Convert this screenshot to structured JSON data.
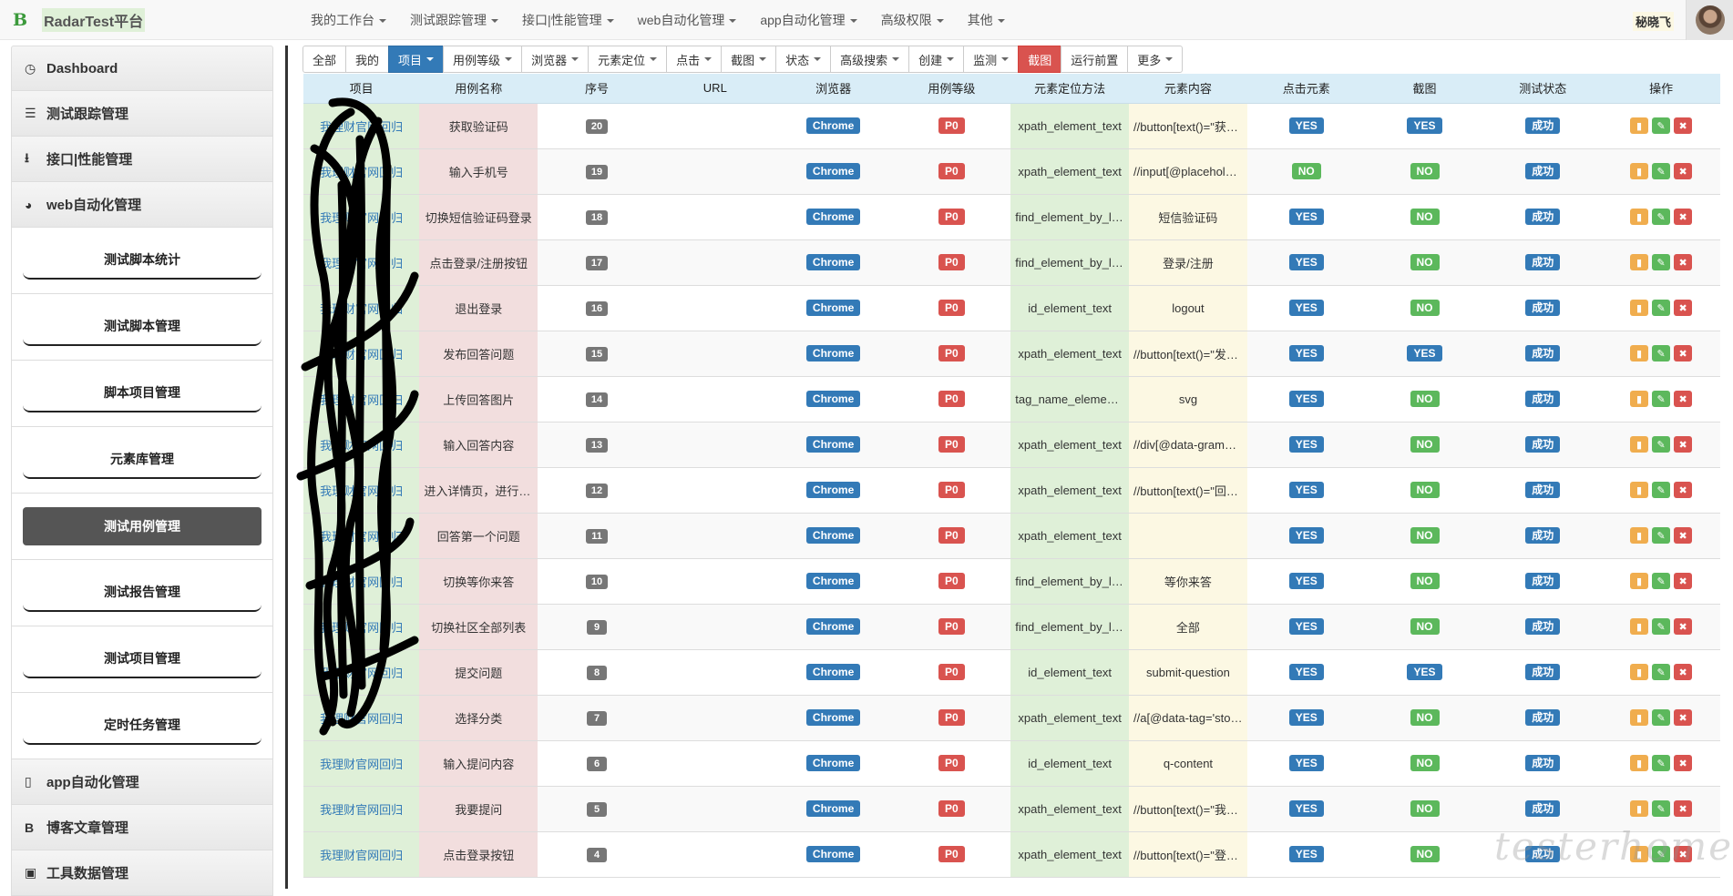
{
  "brand": {
    "logo": "B",
    "name": "RadarTest平台"
  },
  "topnav": [
    "我的工作台",
    "测试跟踪管理",
    "接口|性能管理",
    "web自动化管理",
    "app自动化管理",
    "高级权限",
    "其他"
  ],
  "user": {
    "name": "秘晓飞"
  },
  "sidebar": {
    "top": [
      {
        "label": "Dashboard",
        "icon": "clock-icon"
      },
      {
        "label": "测试跟踪管理",
        "icon": "list-icon"
      },
      {
        "label": "接口|性能管理",
        "icon": "download-icon"
      },
      {
        "label": "web自动化管理",
        "icon": "globe-icon"
      }
    ],
    "sub": [
      {
        "label": "测试脚本统计"
      },
      {
        "label": "测试脚本管理"
      },
      {
        "label": "脚本项目管理"
      },
      {
        "label": "元素库管理"
      },
      {
        "label": "测试用例管理",
        "active": true
      },
      {
        "label": "测试报告管理"
      },
      {
        "label": "测试项目管理"
      },
      {
        "label": "定时任务管理"
      }
    ],
    "bottom": [
      {
        "label": "app自动化管理",
        "icon": "mobile-icon"
      },
      {
        "label": "博客文章管理",
        "icon": "b-icon"
      },
      {
        "label": "工具数据管理",
        "icon": "briefcase-icon"
      }
    ]
  },
  "filters": [
    {
      "label": "全部",
      "caret": false,
      "style": ""
    },
    {
      "label": "我的",
      "caret": false,
      "style": ""
    },
    {
      "label": "项目",
      "caret": true,
      "style": "blue"
    },
    {
      "label": "用例等级",
      "caret": true,
      "style": ""
    },
    {
      "label": "浏览器",
      "caret": true,
      "style": ""
    },
    {
      "label": "元素定位",
      "caret": true,
      "style": ""
    },
    {
      "label": "点击",
      "caret": true,
      "style": ""
    },
    {
      "label": "截图",
      "caret": true,
      "style": ""
    },
    {
      "label": "状态",
      "caret": true,
      "style": ""
    },
    {
      "label": "高级搜索",
      "caret": true,
      "style": ""
    },
    {
      "label": "创建",
      "caret": true,
      "style": ""
    },
    {
      "label": "监测",
      "caret": true,
      "style": ""
    },
    {
      "label": "截图",
      "caret": false,
      "style": "red"
    },
    {
      "label": "运行前置",
      "caret": false,
      "style": ""
    },
    {
      "label": "更多",
      "caret": true,
      "style": ""
    }
  ],
  "table": {
    "columns": [
      "项目",
      "用例名称",
      "序号",
      "URL",
      "浏览器",
      "用例等级",
      "元素定位方法",
      "元素内容",
      "点击元素",
      "截图",
      "测试状态",
      "操作"
    ],
    "rows": [
      {
        "project": "我理财官网回归",
        "name": "获取验证码",
        "seq": "20",
        "url": "",
        "browser": "Chrome",
        "level": "P0",
        "method": "xpath_element_text",
        "element": "//button[text()=\"获取验证码\"]",
        "click": "YES",
        "shot": "YES",
        "status": "成功"
      },
      {
        "project": "我理财官网回归",
        "name": "输入手机号",
        "seq": "19",
        "url": "",
        "browser": "Chrome",
        "level": "P0",
        "method": "xpath_element_text",
        "element": "//input[@placeholder]",
        "click": "NO",
        "shot": "NO",
        "status": "成功"
      },
      {
        "project": "我理财官网回归",
        "name": "切换短信验证码登录",
        "seq": "18",
        "url": "",
        "browser": "Chrome",
        "level": "P0",
        "method": "find_element_by_link",
        "element": "短信验证码",
        "click": "YES",
        "shot": "NO",
        "status": "成功"
      },
      {
        "project": "我理财官网回归",
        "name": "点击登录/注册按钮",
        "seq": "17",
        "url": "",
        "browser": "Chrome",
        "level": "P0",
        "method": "find_element_by_link",
        "element": "登录/注册",
        "click": "YES",
        "shot": "NO",
        "status": "成功"
      },
      {
        "project": "我理财官网回归",
        "name": "退出登录",
        "seq": "16",
        "url": "",
        "browser": "Chrome",
        "level": "P0",
        "method": "id_element_text",
        "element": "logout",
        "click": "YES",
        "shot": "NO",
        "status": "成功"
      },
      {
        "project": "我理财官网回归",
        "name": "发布回答问题",
        "seq": "15",
        "url": "",
        "browser": "Chrome",
        "level": "P0",
        "method": "xpath_element_text",
        "element": "//button[text()=\"发布\"]",
        "click": "YES",
        "shot": "YES",
        "status": "成功"
      },
      {
        "project": "我理财官网回归",
        "name": "上传回答图片",
        "seq": "14",
        "url": "",
        "browser": "Chrome",
        "level": "P0",
        "method": "tag_name_element_text",
        "element": "svg",
        "click": "YES",
        "shot": "NO",
        "status": "成功"
      },
      {
        "project": "我理财官网回归",
        "name": "输入回答内容",
        "seq": "13",
        "url": "",
        "browser": "Chrome",
        "level": "P0",
        "method": "xpath_element_text",
        "element": "//div[@data-grammarly]",
        "click": "YES",
        "shot": "NO",
        "status": "成功"
      },
      {
        "project": "我理财官网回归",
        "name": "进入详情页，进行回答",
        "seq": "12",
        "url": "",
        "browser": "Chrome",
        "level": "P0",
        "method": "xpath_element_text",
        "element": "//button[text()=\"回答\"]",
        "click": "YES",
        "shot": "NO",
        "status": "成功"
      },
      {
        "project": "我理财官网回归",
        "name": "回答第一个问题",
        "seq": "11",
        "url": "",
        "browser": "Chrome",
        "level": "P0",
        "method": "xpath_element_text",
        "element": "",
        "click": "YES",
        "shot": "NO",
        "status": "成功"
      },
      {
        "project": "我理财官网回归",
        "name": "切换等你来答",
        "seq": "10",
        "url": "",
        "browser": "Chrome",
        "level": "P0",
        "method": "find_element_by_link",
        "element": "等你来答",
        "click": "YES",
        "shot": "NO",
        "status": "成功"
      },
      {
        "project": "我理财官网回归",
        "name": "切换社区全部列表",
        "seq": "9",
        "url": "",
        "browser": "Chrome",
        "level": "P0",
        "method": "find_element_by_link",
        "element": "全部",
        "click": "YES",
        "shot": "NO",
        "status": "成功"
      },
      {
        "project": "我理财官网回归",
        "name": "提交问题",
        "seq": "8",
        "url": "",
        "browser": "Chrome",
        "level": "P0",
        "method": "id_element_text",
        "element": "submit-question",
        "click": "YES",
        "shot": "YES",
        "status": "成功"
      },
      {
        "project": "我理财官网回归",
        "name": "选择分类",
        "seq": "7",
        "url": "",
        "browser": "Chrome",
        "level": "P0",
        "method": "xpath_element_text",
        "element": "//a[@data-tag='stock']",
        "click": "YES",
        "shot": "NO",
        "status": "成功"
      },
      {
        "project": "我理财官网回归",
        "name": "输入提问内容",
        "seq": "6",
        "url": "",
        "browser": "Chrome",
        "level": "P0",
        "method": "id_element_text",
        "element": "q-content",
        "click": "YES",
        "shot": "NO",
        "status": "成功"
      },
      {
        "project": "我理财官网回归",
        "name": "我要提问",
        "seq": "5",
        "url": "",
        "browser": "Chrome",
        "level": "P0",
        "method": "xpath_element_text",
        "element": "//button[text()=\"我要提问\"]",
        "click": "YES",
        "shot": "NO",
        "status": "成功"
      },
      {
        "project": "我理财官网回归",
        "name": "点击登录按钮",
        "seq": "4",
        "url": "",
        "browser": "Chrome",
        "level": "P0",
        "method": "xpath_element_text",
        "element": "//button[text()=\"登录\"]",
        "click": "YES",
        "shot": "NO",
        "status": "成功"
      }
    ]
  },
  "colors": {
    "primary": "#337ab7",
    "danger": "#d9534f",
    "success": "#5cb85c",
    "warning": "#f0ad4e"
  },
  "watermark": "testerhome.com"
}
